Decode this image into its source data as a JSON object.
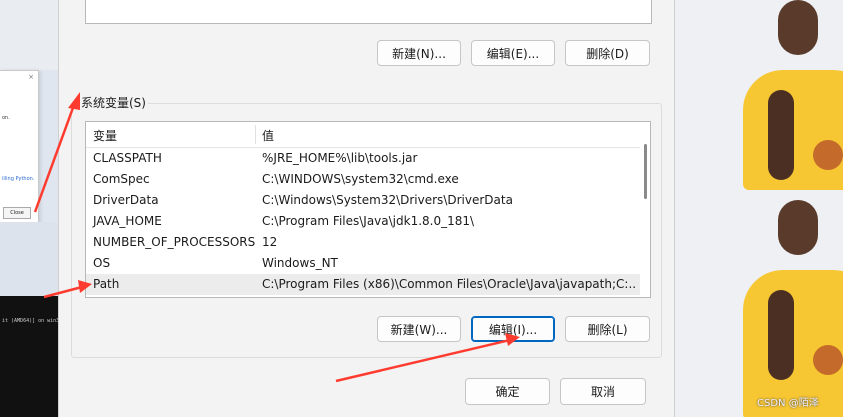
{
  "background": {
    "left_dialog": {
      "close_x": "×",
      "close_button": "Close",
      "text1": "on.",
      "text2": "illing Python."
    },
    "console_text": "it (AMD64)] on win32",
    "watermark": "CSDN @陌泽"
  },
  "user_vars": {
    "buttons": {
      "new": "新建(N)...",
      "edit": "编辑(E)...",
      "delete": "删除(D)"
    }
  },
  "system_vars": {
    "group_title": "系统变量(S)",
    "columns": {
      "variable": "变量",
      "value": "值"
    },
    "rows": [
      {
        "name": "CLASSPATH",
        "value": "%JRE_HOME%\\lib\\tools.jar"
      },
      {
        "name": "ComSpec",
        "value": "C:\\WINDOWS\\system32\\cmd.exe"
      },
      {
        "name": "DriverData",
        "value": "C:\\Windows\\System32\\Drivers\\DriverData"
      },
      {
        "name": "JAVA_HOME",
        "value": "C:\\Program Files\\Java\\jdk1.8.0_181\\"
      },
      {
        "name": "NUMBER_OF_PROCESSORS",
        "value": "12"
      },
      {
        "name": "OS",
        "value": "Windows_NT"
      },
      {
        "name": "Path",
        "value": "C:\\Program Files (x86)\\Common Files\\Oracle\\Java\\javapath;C:..."
      }
    ],
    "selected_row": "Path",
    "buttons": {
      "new": "新建(W)...",
      "edit": "编辑(I)...",
      "delete": "删除(L)"
    }
  },
  "footer": {
    "ok": "确定",
    "cancel": "取消"
  },
  "colors": {
    "arrow": "#ff3b2f",
    "focus_border": "#0067c0",
    "wallpaper_jersey": "#f6c633"
  }
}
